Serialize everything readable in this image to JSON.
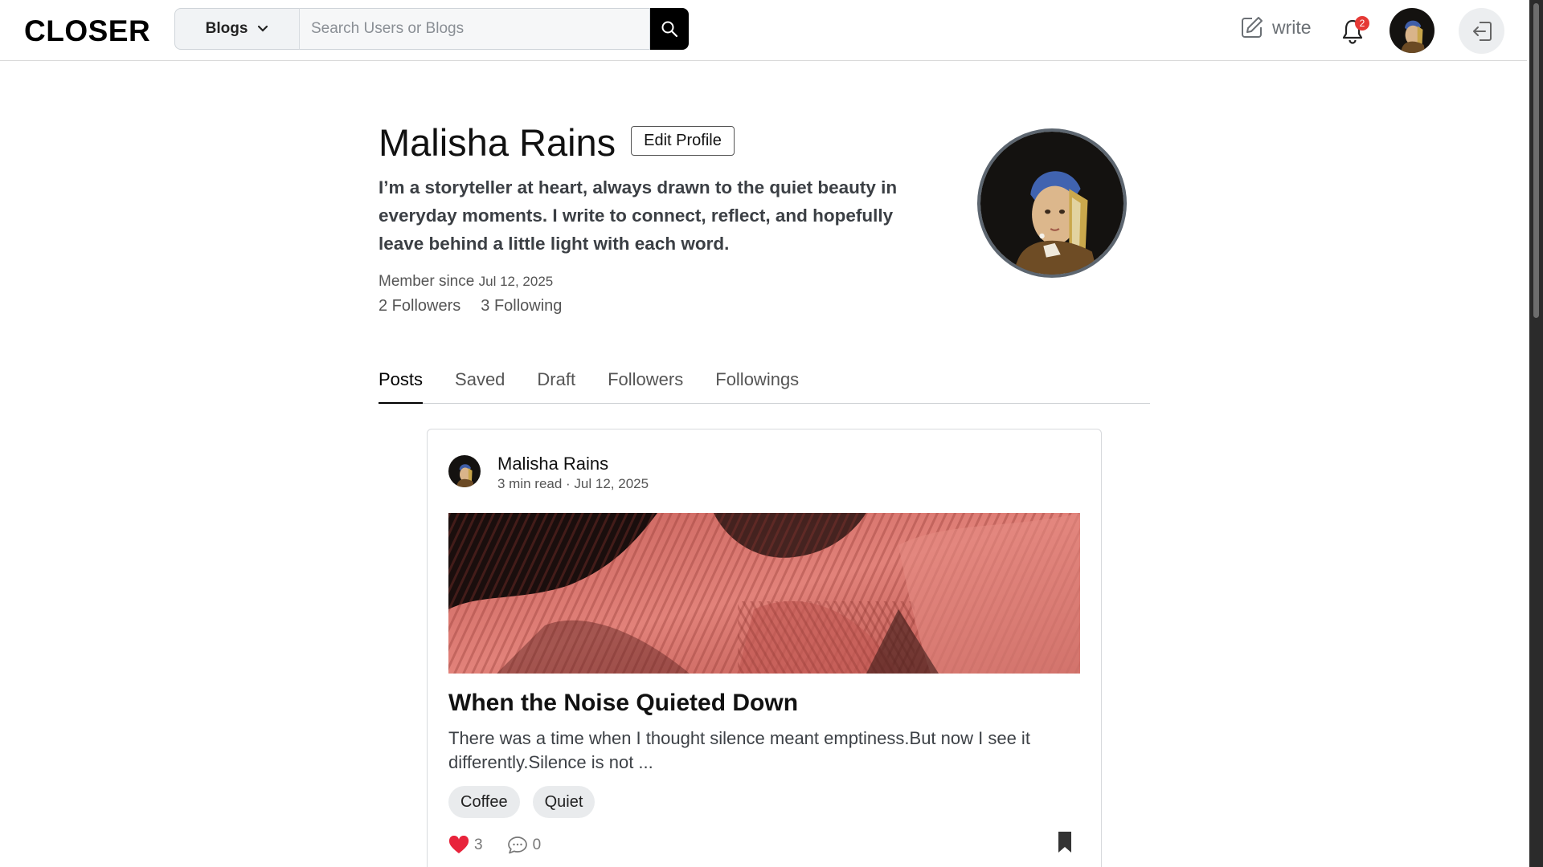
{
  "header": {
    "logo": "CLOSER",
    "category_label": "Blogs",
    "search_placeholder": "Search Users or Blogs",
    "write_label": "write",
    "notification_count": "2"
  },
  "profile": {
    "name": "Malisha Rains",
    "edit_label": "Edit Profile",
    "bio": "I’m a storyteller at heart, always drawn to the quiet beauty in everyday moments. I write to connect, reflect, and hopefully leave behind a little light with each word.",
    "member_since_label": "Member since",
    "member_since_date": "Jul 12, 2025",
    "followers": "2 Followers",
    "following": "3 Following"
  },
  "tabs": [
    {
      "label": "Posts",
      "active": true
    },
    {
      "label": "Saved",
      "active": false
    },
    {
      "label": "Draft",
      "active": false
    },
    {
      "label": "Followers",
      "active": false
    },
    {
      "label": "Followings",
      "active": false
    }
  ],
  "post": {
    "author": "Malisha Rains",
    "meta": "3 min read · Jul 12, 2025",
    "title": "When the Noise Quieted Down",
    "excerpt": "There was a time when I thought silence meant emptiness.But now I see it differently.Silence is not ...",
    "tags": [
      "Coffee",
      "Quiet"
    ],
    "likes": "3",
    "comments": "0",
    "liked": true
  },
  "colors": {
    "like": "#e8233b",
    "badge": "#e53935",
    "search_button": "#000000"
  }
}
